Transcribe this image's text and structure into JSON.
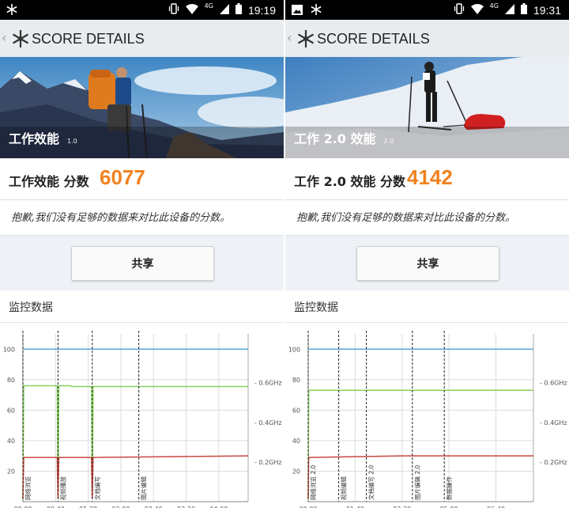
{
  "colors": {
    "accent": "#f0821e",
    "line_blue": "#58a9de",
    "line_green": "#86d25c",
    "line_red": "#c9473f",
    "grid": "#d8dcdf"
  },
  "panels": [
    {
      "status_time": "19:19",
      "status_icons_left": [
        "snowflake-icon"
      ],
      "network_label": "4G",
      "back_symbol": "‹",
      "app_title": "SCORE DETAILS",
      "hero_title": "工作效能",
      "hero_version": "1.0",
      "score_label": "工作效能 分数",
      "score_value": "6077",
      "note": "抱歉,我们没有足够的数据来对比此设备的分数。",
      "share_label": "共享",
      "monitor_title": "监控数据",
      "chart_data": {
        "type": "line",
        "x_ticks": [
          "00:00",
          "00:40",
          "01:20",
          "02:00",
          "02:40",
          "03:20",
          "04:00"
        ],
        "x_tick_seconds": [
          0,
          40,
          80,
          120,
          160,
          200,
          240
        ],
        "xlim": [
          0,
          276
        ],
        "y_left_ticks": [
          "20",
          "40",
          "60",
          "80",
          "100"
        ],
        "ylim": [
          0,
          110
        ],
        "y_right_ticks": [
          "0.2GHz",
          "0.4GHz",
          "0.6GHz"
        ],
        "grid": true,
        "series": [
          {
            "color_key": "line_blue",
            "x": [
              0,
              276
            ],
            "y": [
              100,
              100
            ]
          },
          {
            "color_key": "line_green",
            "x": [
              0,
              1,
              2,
              42,
              43,
              44,
              45,
              58,
              60,
              84,
              85,
              86,
              276
            ],
            "y": [
              2,
              76,
              76,
              76,
              2,
              76,
              76,
              76,
              75.5,
              75.5,
              2,
              75.5,
              75.5
            ]
          },
          {
            "color_key": "line_red",
            "x": [
              0,
              1,
              2,
              42,
              43,
              44,
              84,
              85,
              86,
              276
            ],
            "y": [
              2,
              29,
              29,
              29,
              2,
              29,
              29,
              2,
              29,
              30
            ]
          }
        ],
        "markers": [
          {
            "x": 0,
            "label": "网络浏览"
          },
          {
            "x": 43,
            "label": "视频播放"
          },
          {
            "x": 85,
            "label": "文档编写"
          },
          {
            "x": 142,
            "label": "图片编辑"
          }
        ]
      }
    },
    {
      "status_time": "19:31",
      "status_icons_left": [
        "image-icon",
        "snowflake-icon"
      ],
      "network_label": "4G",
      "back_symbol": "‹",
      "app_title": "SCORE DETAILS",
      "hero_title": "工作 2.0 效能",
      "hero_version": "2.0",
      "score_label": "工作 2.0 效能 分数",
      "score_value": "4142",
      "note": "抱歉,我们没有足够的数据来对比此设备的分数。",
      "share_label": "共享",
      "monitor_title": "监控数据",
      "chart_data": {
        "type": "line",
        "x_ticks": [
          "00:00",
          "01:40",
          "03:20",
          "05:00",
          "06:40"
        ],
        "x_tick_seconds": [
          0,
          100,
          200,
          300,
          400
        ],
        "xlim": [
          0,
          480
        ],
        "y_left_ticks": [
          "20",
          "40",
          "60",
          "80",
          "100"
        ],
        "ylim": [
          0,
          110
        ],
        "y_right_ticks": [
          "0.2GHz",
          "0.4GHz",
          "0.6GHz"
        ],
        "grid": true,
        "series": [
          {
            "color_key": "line_blue",
            "x": [
              0,
              480
            ],
            "y": [
              100,
              100
            ]
          },
          {
            "color_key": "line_green",
            "x": [
              0,
              1,
              2,
              480
            ],
            "y": [
              2,
              73,
              73,
              73
            ]
          },
          {
            "color_key": "line_red",
            "x": [
              0,
              1,
              2,
              200,
              480
            ],
            "y": [
              2,
              29,
              29,
              30,
              30
            ]
          }
        ],
        "markers": [
          {
            "x": 0,
            "label": "网络浏览 2.0"
          },
          {
            "x": 65,
            "label": "视频编辑"
          },
          {
            "x": 124,
            "label": "文档编写 2.0"
          },
          {
            "x": 222,
            "label": "图片编辑 2.0"
          },
          {
            "x": 290,
            "label": "数据操作"
          }
        ]
      }
    }
  ]
}
